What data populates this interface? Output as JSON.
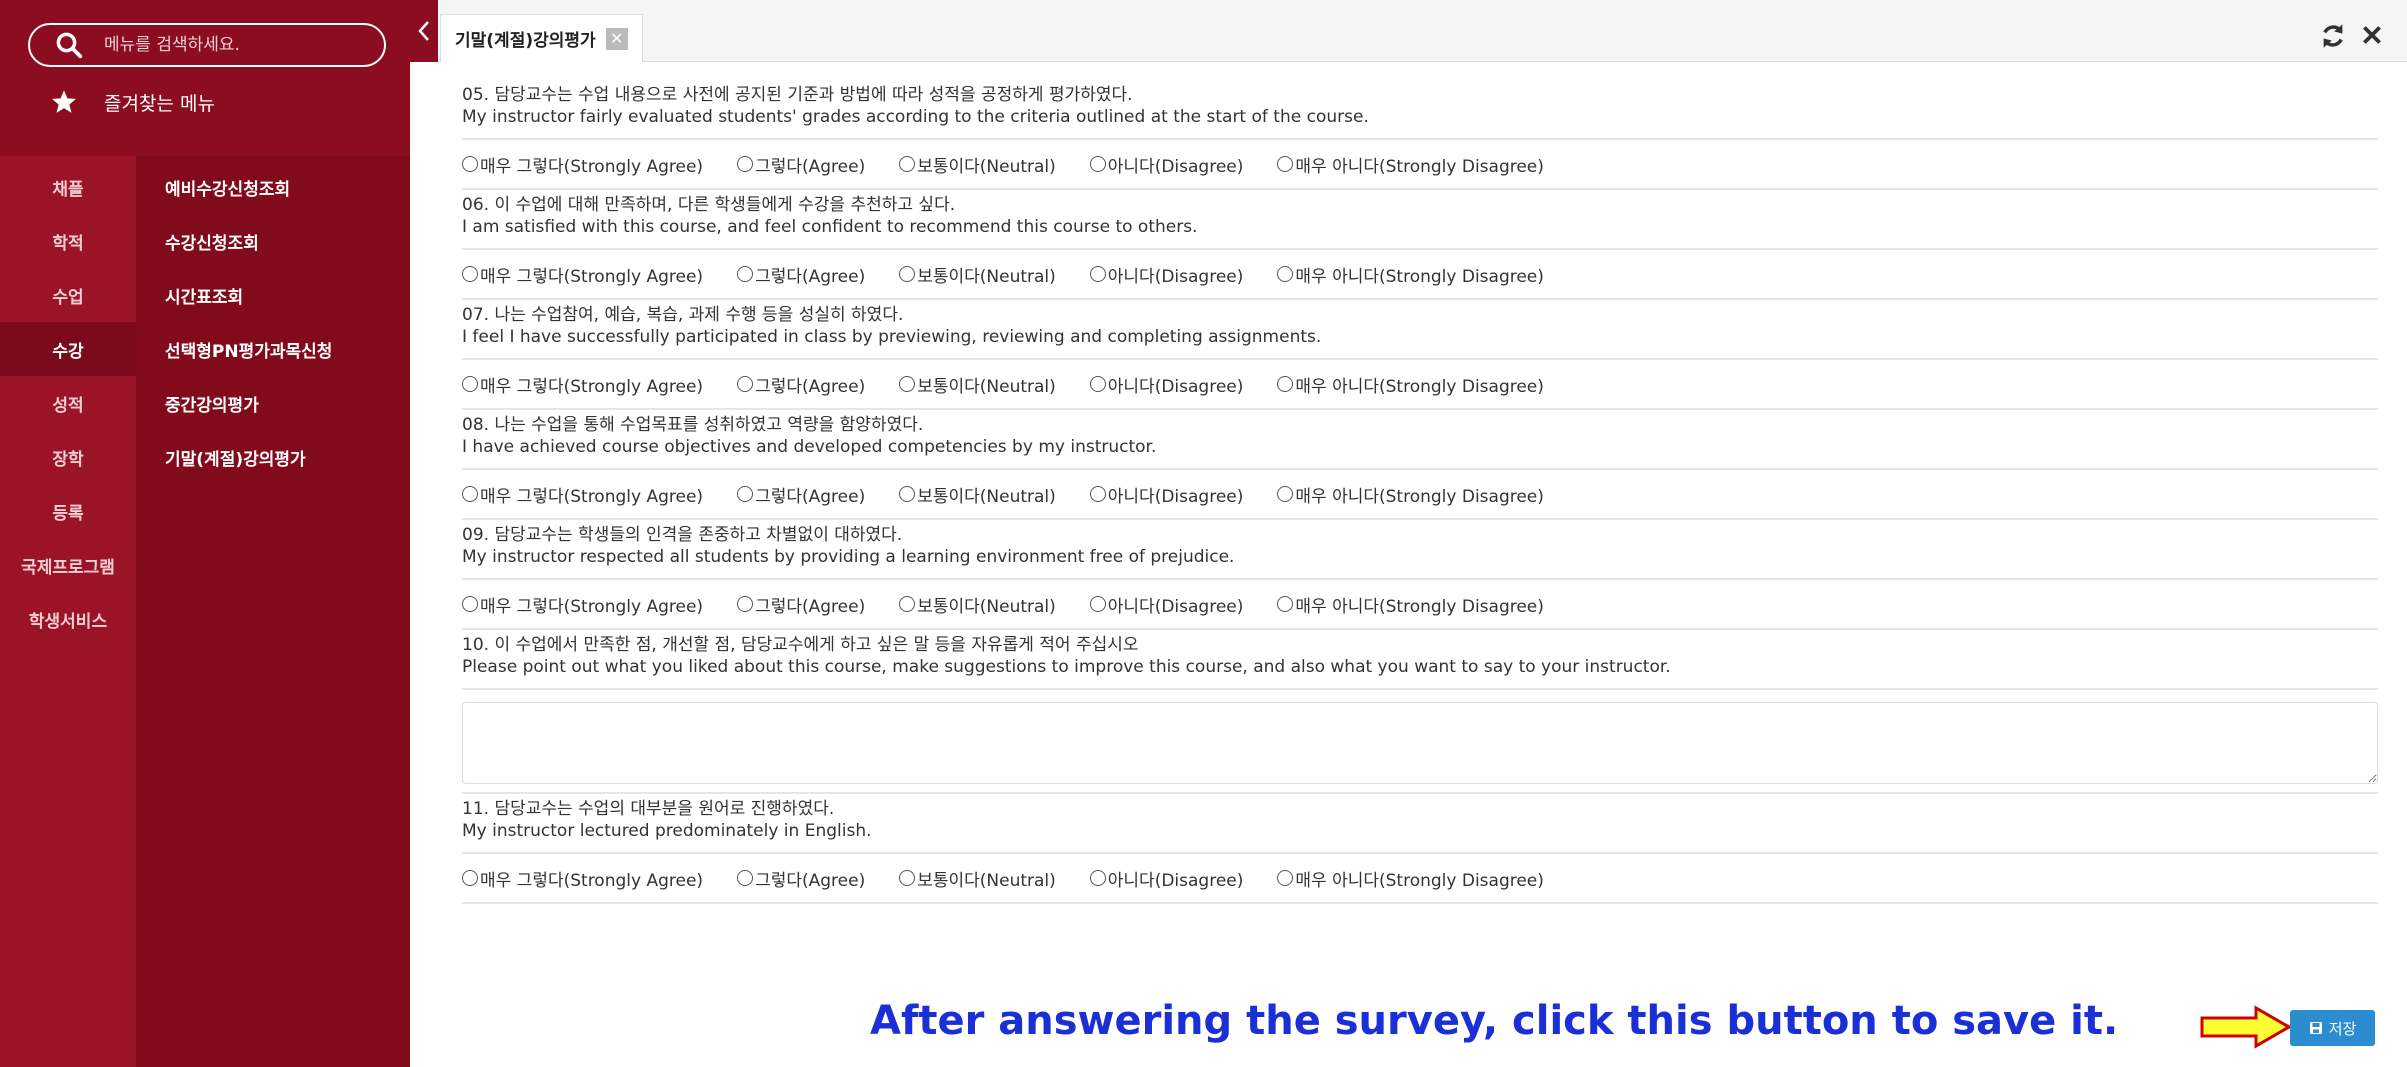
{
  "sidebar": {
    "search_placeholder": "메뉴를 검색하세요.",
    "favorites_label": "즐겨찾는 메뉴",
    "categories": [
      "채플",
      "학적",
      "수업",
      "수강",
      "성적",
      "장학",
      "등록",
      "국제프로그램",
      "학생서비스"
    ],
    "active_category_index": 3,
    "sub_items": [
      "예비수강신청조회",
      "수강신청조회",
      "시간표조회",
      "선택형PN평가과목신청",
      "중간강의평가",
      "기말(계절)강의평가"
    ]
  },
  "tab": {
    "label": "기말(계절)강의평가",
    "close_glyph": "✕"
  },
  "options": [
    "매우 그렇다(Strongly Agree)",
    "그렇다(Agree)",
    "보통이다(Neutral)",
    "아니다(Disagree)",
    "매우 아니다(Strongly Disagree)"
  ],
  "questions": [
    {
      "ko": "05. 담당교수는 수업 내용으로 사전에 공지된 기준과 방법에 따라 성적을 공정하게 평가하였다.",
      "en": "My instructor fairly evaluated students' grades according to the criteria outlined at the start of the course."
    },
    {
      "ko": "06. 이 수업에 대해 만족하며, 다른 학생들에게 수강을 추천하고 싶다.",
      "en": "I am satisfied with this course, and feel confident to recommend this course to others."
    },
    {
      "ko": "07. 나는 수업참여, 예습, 복습, 과제 수행 등을 성실히 하였다.",
      "en": "I feel I have successfully participated in class by previewing, reviewing and completing assignments."
    },
    {
      "ko": "08. 나는 수업을 통해 수업목표를 성취하였고 역량을 함양하였다.",
      "en": "I have achieved course objectives and developed competencies by my instructor."
    },
    {
      "ko": "09. 담당교수는 학생들의 인격을 존중하고 차별없이 대하였다.",
      "en": "My instructor respected all students by providing a learning environment free of prejudice."
    },
    {
      "ko": "10. 이 수업에서 만족한 점, 개선할 점, 담당교수에게 하고 싶은 말 등을 자유롭게 적어 주십시오",
      "en": "Please point out what you liked about this course, make suggestions to improve this course, and also what you want to say to your instructor."
    },
    {
      "ko": "11. 담당교수는 수업의 대부분을 원어로 진행하였다.",
      "en": "My instructor lectured predominately in English."
    }
  ],
  "hint_text": "After answering the survey, click this button to save it.",
  "save_label": "저장",
  "colors": {
    "sidebar_bg": "#8c0d1f",
    "hint": "#1a2fd6",
    "save_button": "#2b8ccf",
    "arrow_fill": "#ffff33",
    "arrow_stroke": "#d00000"
  }
}
